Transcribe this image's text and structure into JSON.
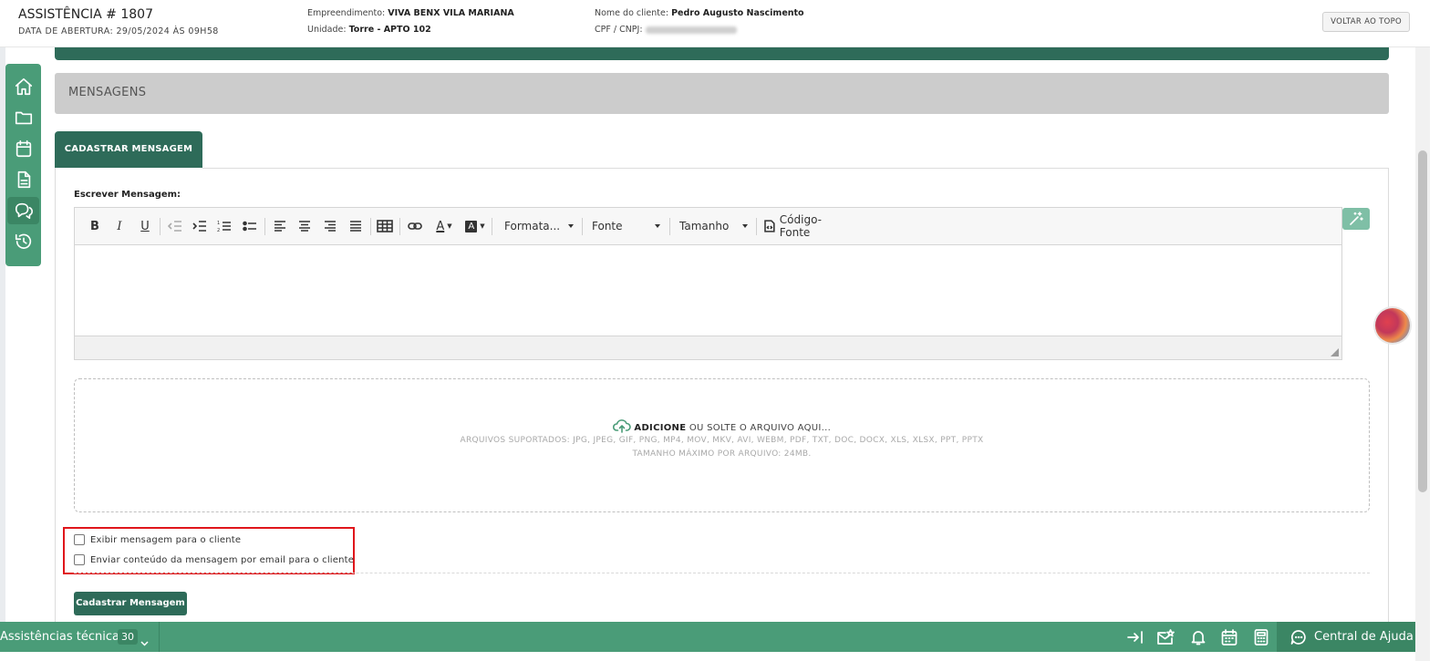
{
  "header": {
    "title": "ASSISTÊNCIA # 1807",
    "opened": "DATA DE ABERTURA: 29/05/2024 ÀS 09H58",
    "empreendimento_label": "Empreendimento:",
    "empreendimento_value": "VIVA BENX VILA MARIANA",
    "unidade_label": "Unidade:",
    "unidade_value": "Torre - APTO 102",
    "cliente_label": "Nome do cliente:",
    "cliente_value": "Pedro Augusto Nascimento",
    "cpf_label": "CPF / CNPJ:",
    "back_to_top": "VOLTAR AO TOPO"
  },
  "sidebar": {
    "items": [
      {
        "icon": "home-icon"
      },
      {
        "icon": "folder-icon"
      },
      {
        "icon": "calendar-icon"
      },
      {
        "icon": "document-icon"
      },
      {
        "icon": "chat-icon",
        "active": true
      },
      {
        "icon": "history-icon"
      }
    ]
  },
  "section": {
    "title": "MENSAGENS"
  },
  "tab": {
    "label": "CADASTRAR MENSAGEM"
  },
  "editor": {
    "label": "Escrever Mensagem:",
    "format_label": "Formata...",
    "font_label": "Fonte",
    "size_label": "Tamanho",
    "source_label": "Código-Fonte"
  },
  "dropzone": {
    "add": "ADICIONE",
    "drop": " OU SOLTE O ARQUIVO AQUI...",
    "supported": "ARQUIVOS SUPORTADOS: JPG, JPEG, GIF, PNG, MP4, MOV, MKV, AVI, WEBM, PDF, TXT, DOC, DOCX, XLS, XLSX, PPT, PPTX",
    "maxsize": "TAMANHO MÁXIMO POR ARQUIVO: 24MB."
  },
  "options": {
    "show_client": "Exibir mensagem para o cliente",
    "send_email": "Enviar conteúdo da mensagem por email para o cliente"
  },
  "submit": "Cadastrar Mensagem",
  "bottom_bar": {
    "title": "Assistências técnicas",
    "count": "30",
    "help": "Central de Ajuda"
  },
  "colors": {
    "brand_dark": "#2e6b59",
    "brand": "#4a9c78",
    "highlight": "#e0161b"
  }
}
